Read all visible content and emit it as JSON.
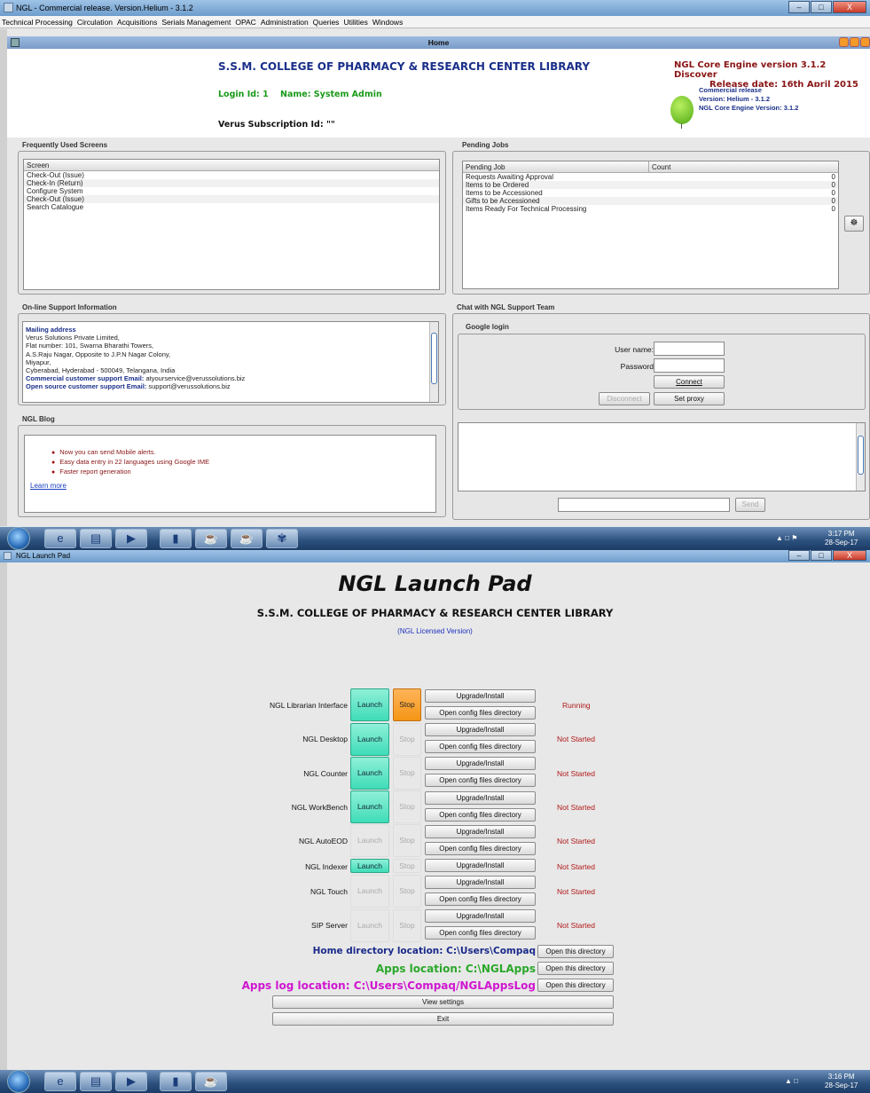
{
  "window": {
    "title": "NGL - Commercial release. Version.Helium - 3.1.2",
    "controls": [
      "–",
      "□",
      "X"
    ]
  },
  "menu": [
    "Technical Processing",
    "Circulation",
    "Acquisitions",
    "Serials Management",
    "OPAC",
    "Administration",
    "Queries",
    "Utilities",
    "Windows"
  ],
  "home": {
    "title": "Home",
    "library": "S.S.M. COLLEGE OF PHARMACY & RESEARCH CENTER LIBRARY",
    "login": "Login Id: 1    Name: System Admin",
    "subscription": "Verus Subscription Id: \"\"",
    "engine_title": "NGL Core Engine version 3.1.2 Discover",
    "release_date": "Release date: 16th April 2015",
    "version_lines": [
      "Commercial release",
      "Version: Helium - 3.1.2",
      "NGL Core Engine Version: 3.1.2"
    ]
  },
  "frequent": {
    "header": "Frequently Used Screens",
    "column": "Screen",
    "rows": [
      "Check-Out (Issue)",
      "Check-In (Return)",
      "Configure System",
      "Check-Out (Issue)",
      "Search Catalogue"
    ]
  },
  "pending": {
    "header": "Pending Jobs",
    "columns": [
      "Pending Job",
      "Count"
    ],
    "rows": [
      {
        "job": "Requests Awaiting Approval",
        "count": "0"
      },
      {
        "job": "Items to be Ordered",
        "count": "0"
      },
      {
        "job": "Items to be Accessioned",
        "count": "0"
      },
      {
        "job": "Gifts to be Accessioned",
        "count": "0"
      },
      {
        "job": "Items Ready For Technical Processing",
        "count": "0"
      }
    ]
  },
  "support": {
    "header": "On-line Support Information",
    "mailing_label": "Mailing address",
    "lines": [
      "Verus Solutions Private Limited,",
      "Flat number: 101, Swarna Bharathi Towers,",
      "A.S.Raju Nagar, Opposite to J.P.N Nagar Colony,",
      "Miyapur,",
      "Cyberabad, Hyderabad - 500049, Telangana, India"
    ],
    "commercial_label": "Commercial customer support Email:",
    "commercial_email": "atyourservice@verussolutions.biz",
    "opensource_label": "Open source customer support Email:",
    "opensource_email": "support@verussolutions.biz"
  },
  "blog": {
    "header": "NGL Blog",
    "items": [
      "Now you can send Mobile alerts.",
      "Easy data entry in 22 languages using Google IME",
      "Faster report generation"
    ],
    "learn_more": "Learn more"
  },
  "chat": {
    "header": "Chat with NGL Support Team",
    "google_login": "Google login",
    "username_label": "User name:",
    "password_label": "Password",
    "connect": "Connect",
    "disconnect": "Disconnect",
    "set_proxy": "Set proxy",
    "send": "Send"
  },
  "taskbar1": {
    "time": "3:17 PM",
    "date": "28-Sep-17"
  },
  "launchpad": {
    "window_title": "NGL Launch Pad",
    "title": "NGL Launch Pad",
    "library": "S.S.M. COLLEGE OF PHARMACY & RESEARCH CENTER LIBRARY",
    "license": "(NGL Licensed Version)",
    "launch_label": "Launch",
    "stop_label": "Stop",
    "upgrade_label": "Upgrade/Install",
    "config_label": "Open config files directory",
    "apps": [
      {
        "name": "NGL Librarian Interface",
        "status": "Running"
      },
      {
        "name": "NGL Desktop",
        "status": "Not Started"
      },
      {
        "name": "NGL Counter",
        "status": "Not Started"
      },
      {
        "name": "NGL WorkBench",
        "status": "Not Started"
      },
      {
        "name": "NGL AutoEOD",
        "status": "Not Started"
      },
      {
        "name": "NGL Indexer",
        "status": "Not Started"
      },
      {
        "name": "NGL Touch",
        "status": "Not Started"
      },
      {
        "name": "SIP Server",
        "status": "Not Started"
      }
    ],
    "home_dir": "Home directory location: C:\\Users\\Compaq",
    "apps_loc": "Apps location: C:\\NGLApps",
    "apps_log": "Apps log location: C:\\Users\\Compaq/NGLAppsLog",
    "open_dir": "Open this directory",
    "view_settings": "View settings",
    "exit": "Exit",
    "colors": {
      "home_dir": "#1a2a8a",
      "apps_loc": "#2aa82a",
      "apps_log": "#d015d0"
    }
  },
  "taskbar2": {
    "time": "3:16 PM",
    "date": "28-Sep-17"
  }
}
